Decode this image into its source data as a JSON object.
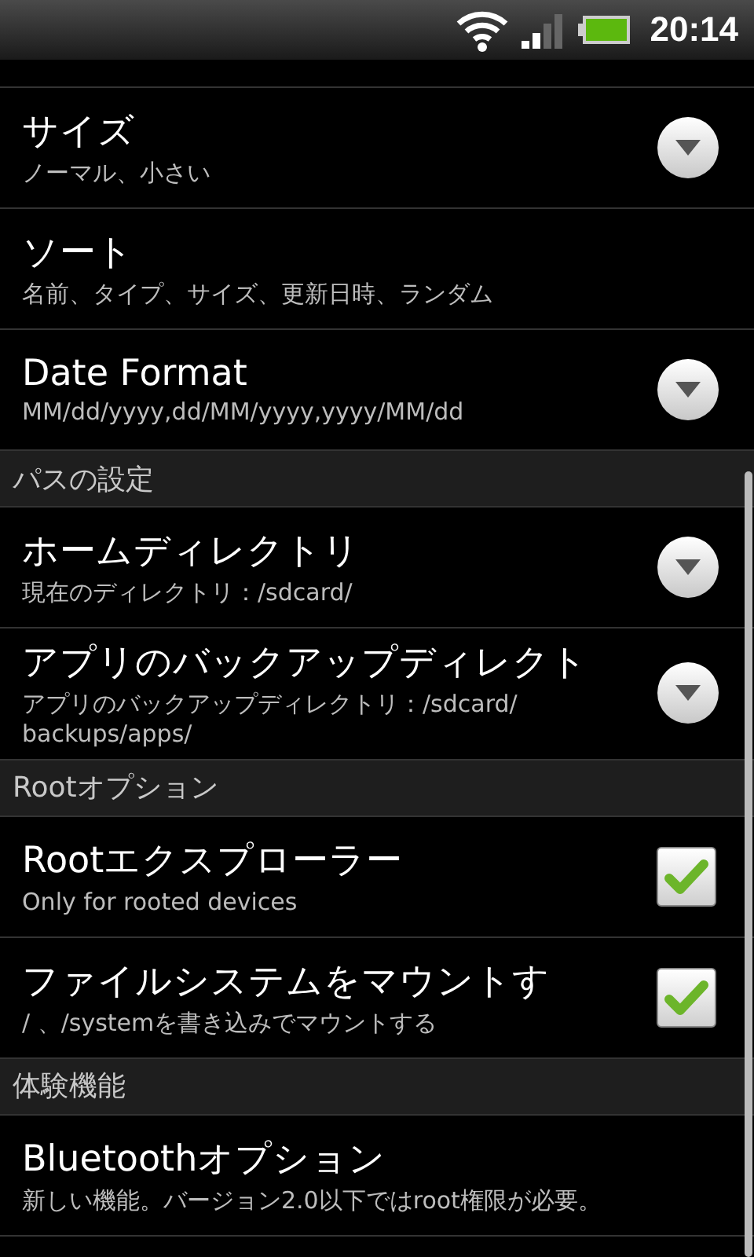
{
  "status_bar": {
    "time": "20:14"
  },
  "list": [
    {
      "kind": "dropdown",
      "title": "サイズ",
      "summary": "ノーマル、小さい"
    },
    {
      "kind": "plain",
      "title": "ソート",
      "summary": "名前、タイプ、サイズ、更新日時、ランダム"
    },
    {
      "kind": "dropdown",
      "title": "Date Format",
      "summary": "MM/dd/yyyy,dd/MM/yyyy,yyyy/MM/dd"
    },
    {
      "kind": "header",
      "title": "パスの設定"
    },
    {
      "kind": "dropdown",
      "title": "ホームディレクトリ",
      "summary": "現在のディレクトリ：/sdcard/"
    },
    {
      "kind": "dropdown",
      "title": "アプリのバックアップディレクト",
      "summary": "アプリのバックアップディレクトリ：/sdcard/ backups/apps/"
    },
    {
      "kind": "header",
      "title": "Rootオプション"
    },
    {
      "kind": "checkbox",
      "title": "Rootエクスプローラー",
      "summary": "Only for rooted devices",
      "checked": true
    },
    {
      "kind": "checkbox",
      "title": "ファイルシステムをマウントす",
      "summary": "/ 、/systemを書き込みでマウントする",
      "checked": true
    },
    {
      "kind": "header",
      "title": "体験機能"
    },
    {
      "kind": "plain",
      "title": "Bluetoothオプション",
      "summary": "新しい機能。バージョン2.0以下ではroot権限が必要。"
    }
  ]
}
